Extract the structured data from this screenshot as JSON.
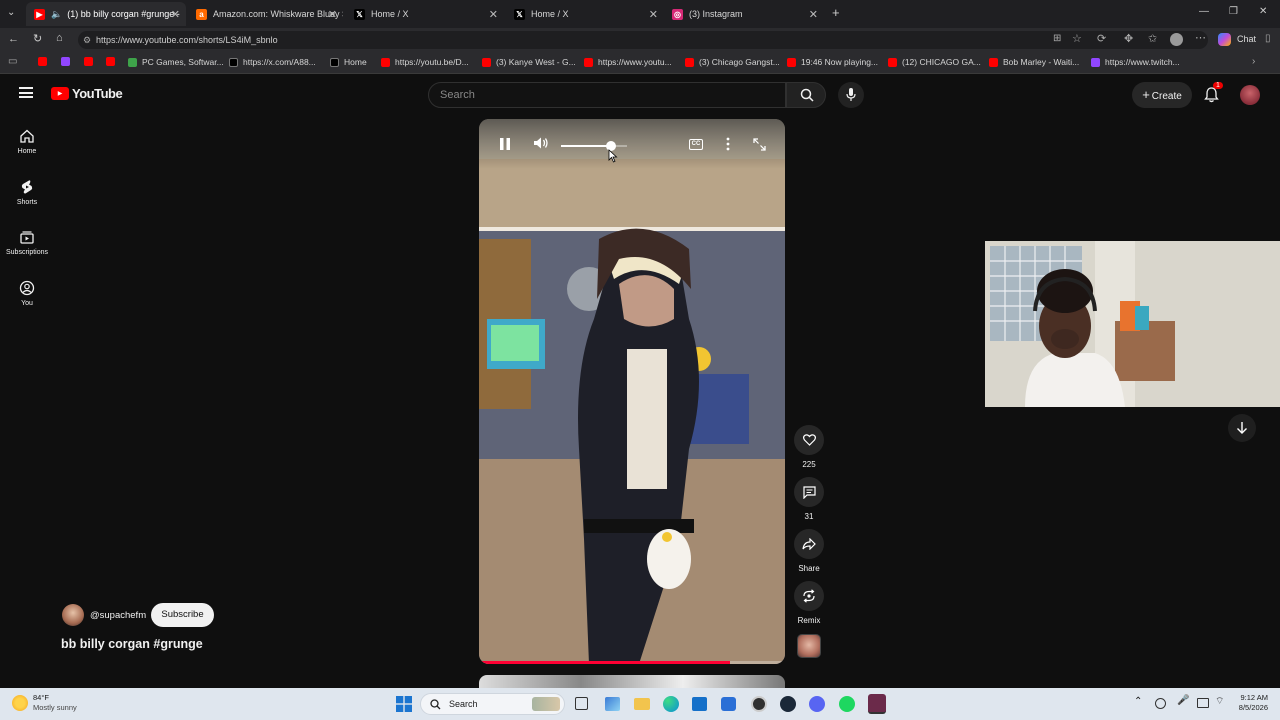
{
  "browser": {
    "tabs": [
      {
        "title": "(1) bb billy corgan #grunge -",
        "active": true,
        "icon": "youtube-icon",
        "color": "#ff0000"
      },
      {
        "title": "Amazon.com: Whiskware Bluey St",
        "active": false,
        "icon": "amazon-icon",
        "color": "#ff6a00"
      },
      {
        "title": "Home / X",
        "active": false,
        "icon": "x-icon",
        "color": "#000000"
      },
      {
        "title": "Home / X",
        "active": false,
        "icon": "x-icon",
        "color": "#000000"
      },
      {
        "title": "(3) Instagram",
        "active": false,
        "icon": "instagram-icon",
        "color": "#d62976"
      }
    ],
    "url": "https://www.youtube.com/shorts/LS4iM_sbnlo",
    "chat_label": "Chat",
    "bookmarks": [
      {
        "label": "",
        "icon": "youtube-icon"
      },
      {
        "label": "",
        "icon": "twitch-icon"
      },
      {
        "label": "",
        "icon": "youtube-icon"
      },
      {
        "label": "",
        "icon": "youtube-icon"
      },
      {
        "label": "PC Games, Softwar...",
        "icon": "game-icon"
      },
      {
        "label": "https://x.com/A88...",
        "icon": "x-icon"
      },
      {
        "label": "Home",
        "icon": "x-icon"
      },
      {
        "label": "https://youtu.be/D...",
        "icon": "youtube-icon"
      },
      {
        "label": "(3) Kanye West - G...",
        "icon": "youtube-icon"
      },
      {
        "label": "https://www.youtu...",
        "icon": "youtube-icon"
      },
      {
        "label": "(3) Chicago Gangst...",
        "icon": "youtube-icon"
      },
      {
        "label": "19:46 Now playing...",
        "icon": "youtube-icon"
      },
      {
        "label": "(12) CHICAGO GA...",
        "icon": "youtube-icon"
      },
      {
        "label": "Bob Marley - Waiti...",
        "icon": "youtube-icon"
      },
      {
        "label": "https://www.twitch...",
        "icon": "twitch-icon"
      }
    ]
  },
  "youtube": {
    "logo_text": "YouTube",
    "search_placeholder": "Search",
    "create_label": "Create",
    "notification_count": "1",
    "nav": [
      {
        "label": "Home",
        "icon": "home-icon"
      },
      {
        "label": "Shorts",
        "icon": "shorts-icon"
      },
      {
        "label": "Subscriptions",
        "icon": "subscriptions-icon"
      },
      {
        "label": "You",
        "icon": "account-icon"
      }
    ],
    "volume_level": 0.75,
    "actions": [
      {
        "label": "225",
        "icon": "like-icon"
      },
      {
        "label": "31",
        "icon": "comment-icon"
      },
      {
        "label": "Share",
        "icon": "share-icon"
      },
      {
        "label": "Remix",
        "icon": "remix-icon"
      }
    ],
    "channel": "@supachefm",
    "subscribe_label": "Subscribe",
    "video_title": "bb billy corgan #grunge",
    "progress": 0.82
  },
  "taskbar": {
    "temp": "84°F",
    "weather": "Mostly sunny",
    "search_label": "Search",
    "time": "9:12 AM",
    "date": "8/5/2026"
  }
}
